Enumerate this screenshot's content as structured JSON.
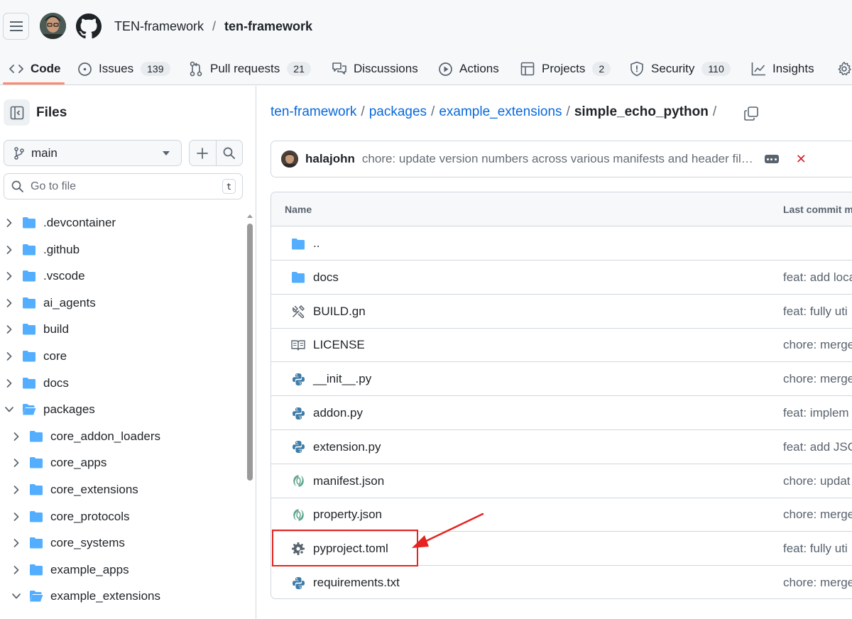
{
  "header": {
    "owner": "TEN-framework",
    "separator": "/",
    "repo": "ten-framework"
  },
  "tabs": [
    {
      "label": "Code",
      "icon": "code-icon",
      "count": ""
    },
    {
      "label": "Issues",
      "icon": "issue-icon",
      "count": "139"
    },
    {
      "label": "Pull requests",
      "icon": "pull-request-icon",
      "count": "21"
    },
    {
      "label": "Discussions",
      "icon": "discussion-icon",
      "count": ""
    },
    {
      "label": "Actions",
      "icon": "play-icon",
      "count": ""
    },
    {
      "label": "Projects",
      "icon": "table-icon",
      "count": "2"
    },
    {
      "label": "Security",
      "icon": "shield-icon",
      "count": "110"
    },
    {
      "label": "Insights",
      "icon": "graph-icon",
      "count": ""
    }
  ],
  "sidebar": {
    "title": "Files",
    "branch": "main",
    "goto_placeholder": "Go to file",
    "goto_shortcut": "t",
    "tree": [
      {
        "label": ".devcontainer",
        "expanded": false,
        "depth": 0
      },
      {
        "label": ".github",
        "expanded": false,
        "depth": 0
      },
      {
        "label": ".vscode",
        "expanded": false,
        "depth": 0
      },
      {
        "label": "ai_agents",
        "expanded": false,
        "depth": 0
      },
      {
        "label": "build",
        "expanded": false,
        "depth": 0
      },
      {
        "label": "core",
        "expanded": false,
        "depth": 0
      },
      {
        "label": "docs",
        "expanded": false,
        "depth": 0
      },
      {
        "label": "packages",
        "expanded": true,
        "depth": 0
      },
      {
        "label": "core_addon_loaders",
        "expanded": false,
        "depth": 1
      },
      {
        "label": "core_apps",
        "expanded": false,
        "depth": 1
      },
      {
        "label": "core_extensions",
        "expanded": false,
        "depth": 1
      },
      {
        "label": "core_protocols",
        "expanded": false,
        "depth": 1
      },
      {
        "label": "core_systems",
        "expanded": false,
        "depth": 1
      },
      {
        "label": "example_apps",
        "expanded": false,
        "depth": 1
      },
      {
        "label": "example_extensions",
        "expanded": true,
        "depth": 1
      }
    ]
  },
  "breadcrumb": {
    "parts": [
      "ten-framework",
      "packages",
      "example_extensions"
    ],
    "current": "simple_echo_python",
    "trailing_sep": "/"
  },
  "commit": {
    "author": "halajohn",
    "message": "chore: update version numbers across various manifests and header fil…"
  },
  "table": {
    "col_name": "Name",
    "col_commit": "Last commit m",
    "rows": [
      {
        "name": "..",
        "icon": "folder-icon",
        "commit": ""
      },
      {
        "name": "docs",
        "icon": "folder-icon",
        "commit": "feat: add loca"
      },
      {
        "name": "BUILD.gn",
        "icon": "tools-icon",
        "commit": "feat: fully uti"
      },
      {
        "name": "LICENSE",
        "icon": "book-icon",
        "commit": "chore: merge"
      },
      {
        "name": "__init__.py",
        "icon": "python-icon",
        "commit": "chore: merge"
      },
      {
        "name": "addon.py",
        "icon": "python-icon",
        "commit": "feat: implem"
      },
      {
        "name": "extension.py",
        "icon": "python-icon",
        "commit": "feat: add JSO"
      },
      {
        "name": "manifest.json",
        "icon": "json-icon",
        "commit": "chore: updat"
      },
      {
        "name": "property.json",
        "icon": "json-icon",
        "commit": "chore: merge"
      },
      {
        "name": "pyproject.toml",
        "icon": "gear-icon",
        "commit": "feat: fully uti"
      },
      {
        "name": "requirements.txt",
        "icon": "python-icon",
        "commit": "chore: merge"
      }
    ]
  },
  "annotation": {
    "highlighted_file": "pyproject.toml",
    "color": "#e5231f"
  },
  "colors": {
    "link": "#0969da",
    "folder": "#54aeff",
    "tab_underline": "#fd8c73"
  }
}
